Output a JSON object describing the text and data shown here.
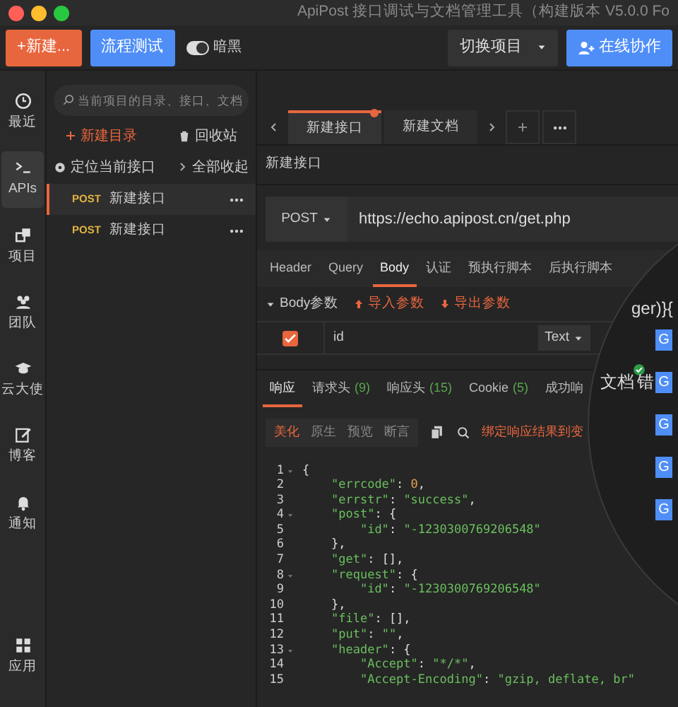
{
  "window": {
    "title": "ApiPost 接口调试与文档管理工具（构建版本 V5.0.0 Fo"
  },
  "toolbar": {
    "new_button": "+新建...",
    "flow_test_button": "流程测试",
    "dark_toggle": {
      "label": "暗黑",
      "on": true
    },
    "switch_project": "切换项目",
    "collab_button": "在线协作"
  },
  "nav": [
    {
      "label": "最近",
      "selected": false
    },
    {
      "label": "APIs",
      "selected": true
    },
    {
      "label": "项目",
      "selected": false
    },
    {
      "label": "团队",
      "selected": false
    },
    {
      "label": "云大使",
      "selected": false
    },
    {
      "label": "博客",
      "selected": false
    },
    {
      "label": "通知",
      "selected": false
    },
    {
      "label": "应用",
      "selected": false
    }
  ],
  "sidebar": {
    "search": {
      "placeholder": "当前项目的目录、接口、文档"
    },
    "new_folder": "新建目录",
    "recycle": "回收站",
    "locate": "定位当前接口",
    "collapse_all": "全部收起",
    "items": [
      {
        "method": "POST",
        "name": "新建接口",
        "selected": true
      },
      {
        "method": "POST",
        "name": "新建接口",
        "selected": false
      }
    ]
  },
  "tabs": [
    {
      "label": "新建接口",
      "selected": true,
      "modified": true
    },
    {
      "label": "新建文档",
      "selected": false,
      "modified": false
    }
  ],
  "request": {
    "name": "新建接口",
    "method": "POST",
    "url": "https://echo.apipost.cn/get.php",
    "tabs": [
      {
        "label": "Header",
        "selected": false
      },
      {
        "label": "Query",
        "selected": false
      },
      {
        "label": "Body",
        "selected": true
      },
      {
        "label": "认证",
        "selected": false
      },
      {
        "label": "预执行脚本",
        "selected": false
      },
      {
        "label": "后执行脚本",
        "selected": false
      }
    ],
    "body_label": "Body参数",
    "import": "导入参数",
    "export": "导出参数",
    "params": [
      {
        "checked": true,
        "name": "id",
        "type": "Text"
      }
    ]
  },
  "response": {
    "tabs": [
      {
        "label": "响应",
        "selected": true
      },
      {
        "label": "请求头",
        "count": "(9)",
        "selected": false
      },
      {
        "label": "响应头",
        "count": "(15)",
        "selected": false
      },
      {
        "label": "Cookie",
        "count": "(5)",
        "selected": false
      },
      {
        "label": "成功响",
        "selected": false
      }
    ],
    "views": [
      {
        "label": "美化",
        "selected": true
      },
      {
        "label": "原生",
        "selected": false
      },
      {
        "label": "预览",
        "selected": false
      },
      {
        "label": "断言",
        "selected": false
      }
    ],
    "bind_link": "绑定响应结果到变",
    "lines": [
      {
        "number": "1",
        "text": "{",
        "fold": true
      },
      {
        "number": "2",
        "text": "    \"errcode\": 0,"
      },
      {
        "number": "3",
        "text": "    \"errstr\": \"success\","
      },
      {
        "number": "4",
        "text": "    \"post\": {",
        "fold": true
      },
      {
        "number": "5",
        "text": "        \"id\": \"-1230300769206548\""
      },
      {
        "number": "6",
        "text": "    },"
      },
      {
        "number": "7",
        "text": "    \"get\": [],"
      },
      {
        "number": "8",
        "text": "    \"request\": {",
        "fold": true
      },
      {
        "number": "9",
        "text": "        \"id\": \"-1230300769206548\""
      },
      {
        "number": "10",
        "text": "    },"
      },
      {
        "number": "11",
        "text": "    \"file\": [],"
      },
      {
        "number": "12",
        "text": "    \"put\": \"\","
      },
      {
        "number": "13",
        "text": "    \"header\": {",
        "fold": true
      },
      {
        "number": "14",
        "text": "        \"Accept\": \"*/*\","
      },
      {
        "number": "15",
        "text": "        \"Accept-Encoding\": \"gzip, deflate, br\""
      }
    ]
  },
  "lens": {
    "fragment_top": "ger)}{",
    "fragment_doc": "文档",
    "fragment_error": "错",
    "badges": [
      "G",
      "G",
      "G",
      "G",
      "G"
    ]
  }
}
